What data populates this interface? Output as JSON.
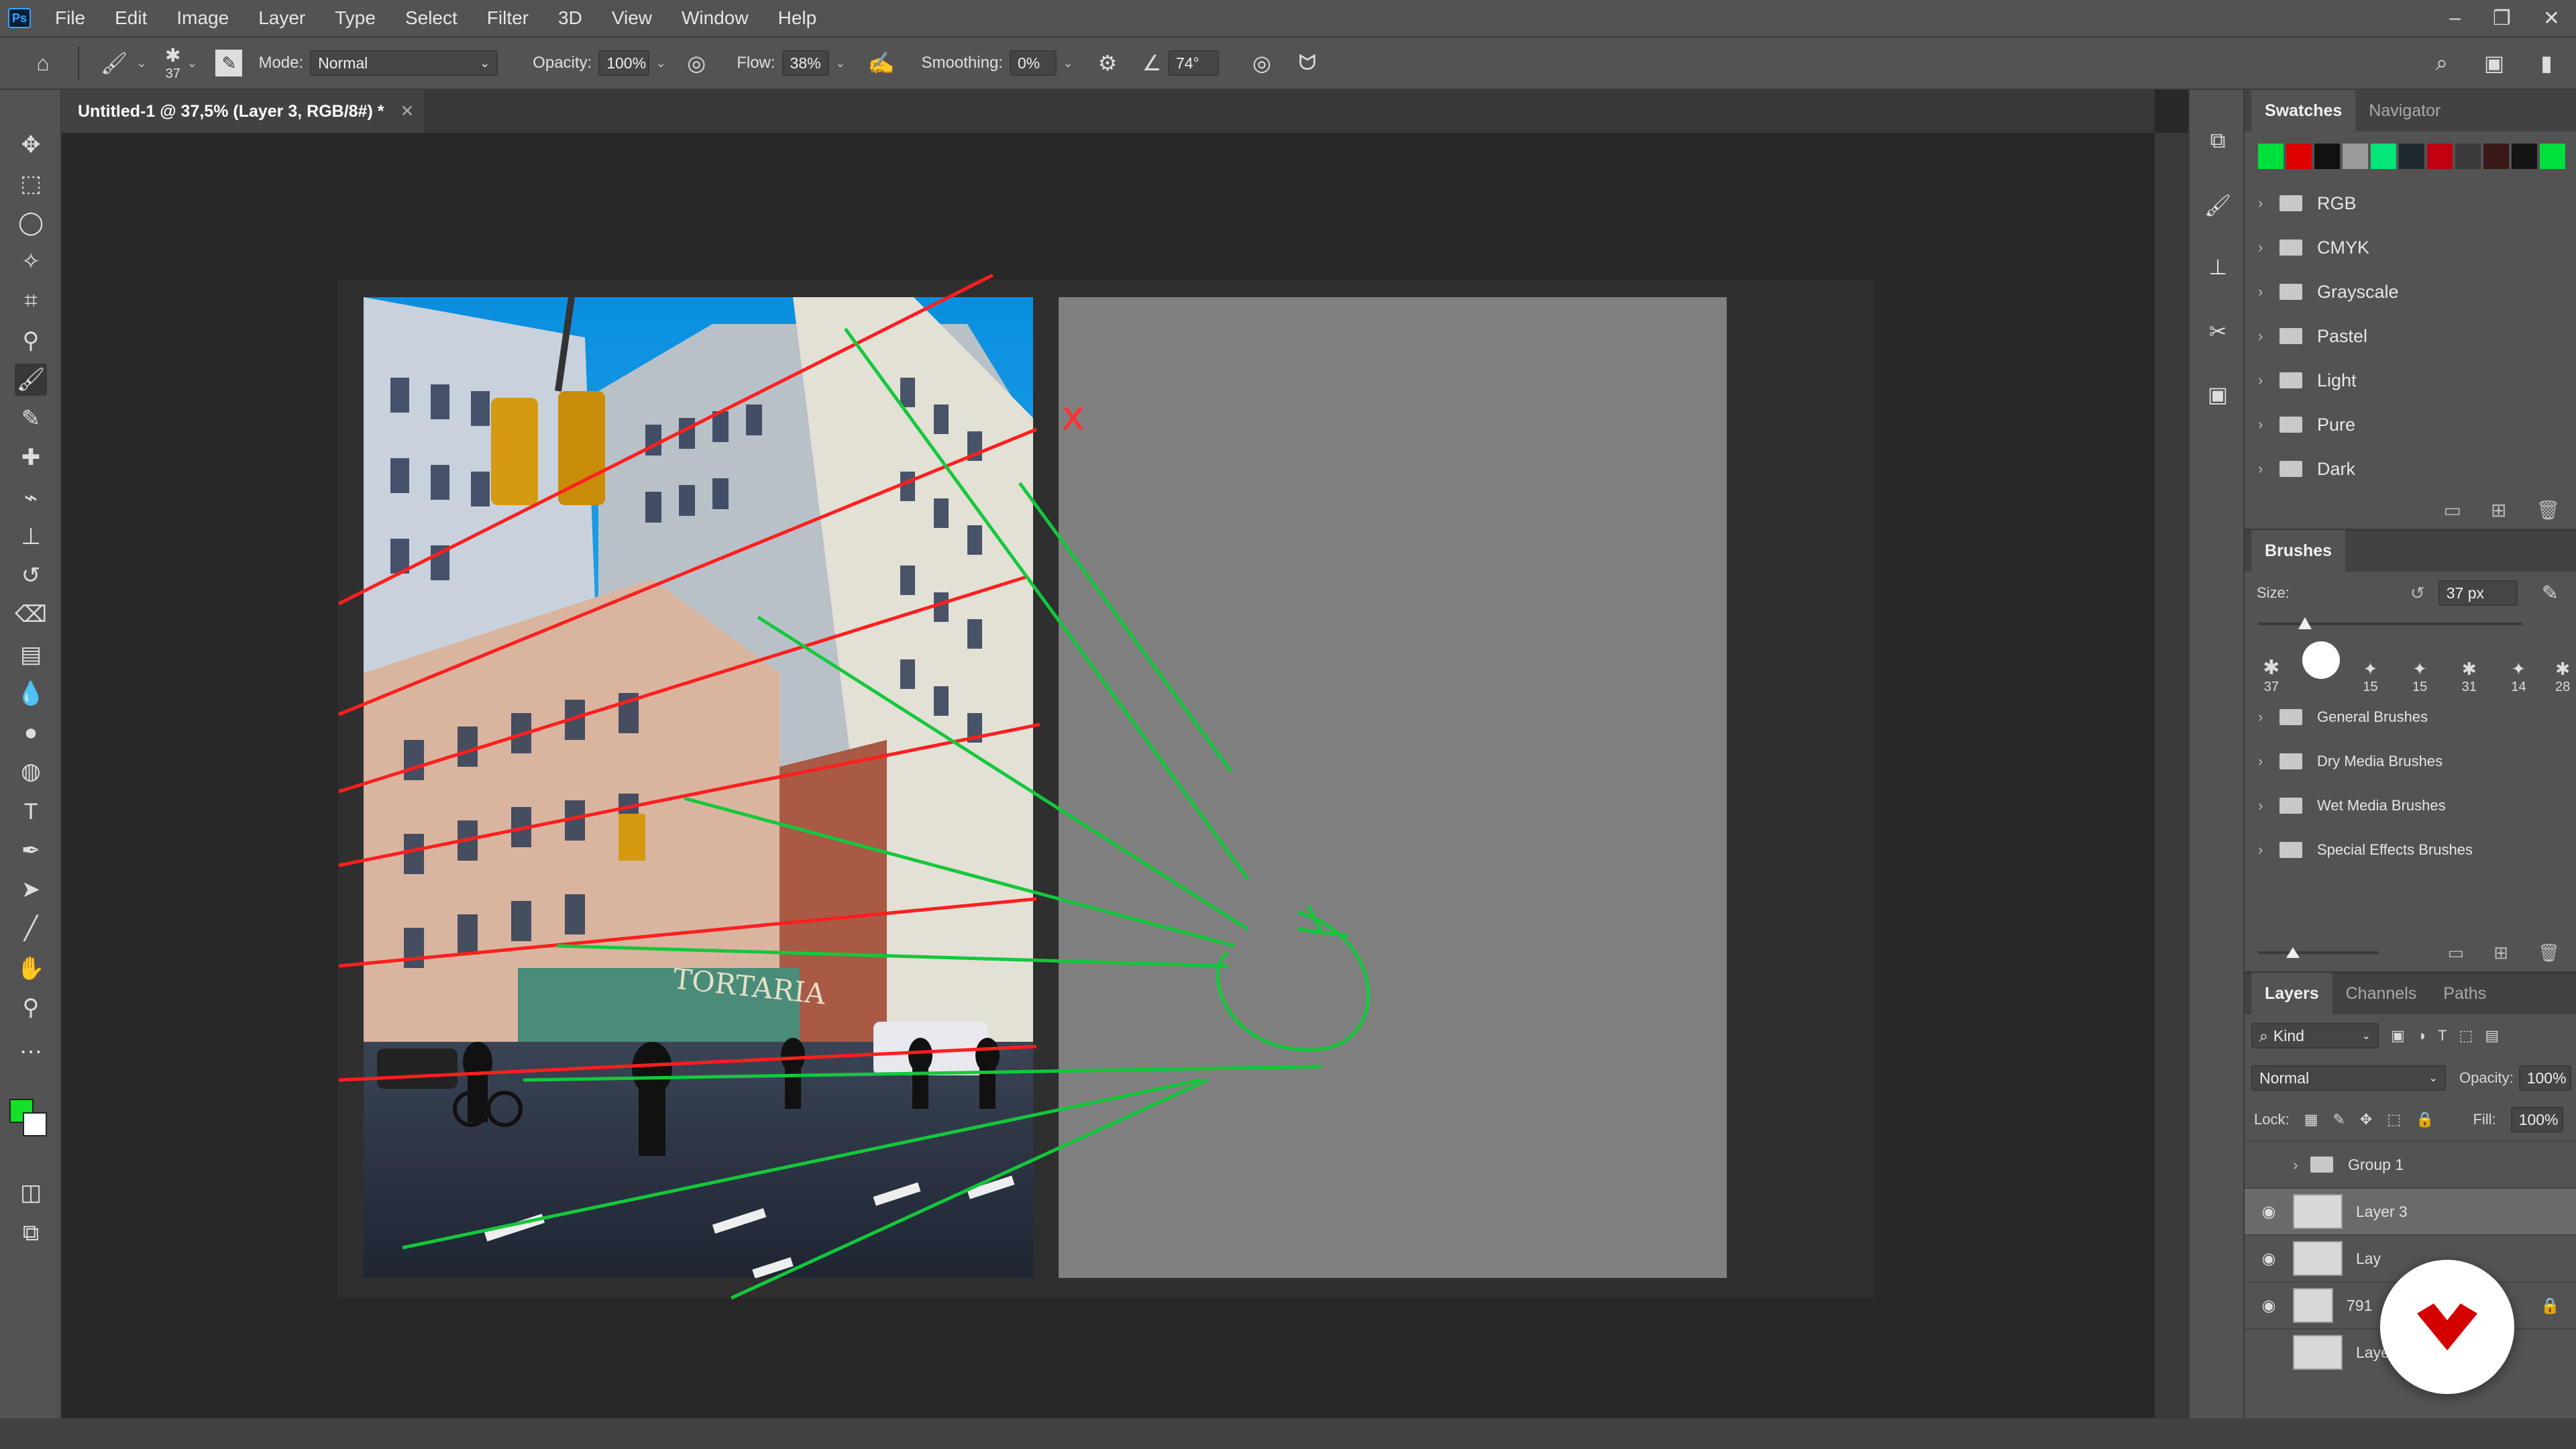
{
  "menu": [
    "File",
    "Edit",
    "Image",
    "Layer",
    "Type",
    "Select",
    "Filter",
    "3D",
    "View",
    "Window",
    "Help"
  ],
  "app_logo": "Ps",
  "options": {
    "brush_size": "37",
    "mode_label": "Mode:",
    "mode_value": "Normal",
    "opacity_label": "Opacity:",
    "opacity_value": "100%",
    "flow_label": "Flow:",
    "flow_value": "38%",
    "smoothing_label": "Smoothing:",
    "smoothing_value": "0%",
    "angle_value": "74°"
  },
  "document_tab": "Untitled-1 @ 37,5% (Layer 3, RGB/8#) *",
  "swatch_panel": {
    "tabs": [
      "Swatches",
      "Navigator"
    ],
    "colors": [
      "#00e03c",
      "#e00000",
      "#111111",
      "#9a9a9a",
      "#00e678",
      "#1e2a30",
      "#c00010",
      "#3a3a3a",
      "#3a1818",
      "#151515",
      "#00e03c",
      "#1a1a1a"
    ],
    "groups": [
      "RGB",
      "CMYK",
      "Grayscale",
      "Pastel",
      "Light",
      "Pure",
      "Dark"
    ]
  },
  "brushes_panel": {
    "title": "Brushes",
    "size_label": "Size:",
    "size_value": "37 px",
    "presets": [
      "37",
      "",
      "15",
      "15",
      "31",
      "14",
      "28"
    ],
    "groups": [
      "General Brushes",
      "Dry Media Brushes",
      "Wet Media Brushes",
      "Special Effects Brushes"
    ]
  },
  "layers_panel": {
    "tabs": [
      "Layers",
      "Channels",
      "Paths"
    ],
    "kind_label": "Kind",
    "blend_mode": "Normal",
    "opacity_label": "Opacity:",
    "opacity_value": "100%",
    "lock_label": "Lock:",
    "fill_label": "Fill:",
    "fill_value": "100%",
    "layers": [
      "Group 1",
      "Layer 3",
      "Lay",
      "791",
      "Layer 2"
    ]
  },
  "canvas": {
    "sign_text": "TORTARIA",
    "red_mark": "x"
  },
  "colors": {
    "foreground": "#14e028",
    "background": "#ffffff",
    "guide_red": "#ff1e1e",
    "guide_green": "#14c83c"
  }
}
